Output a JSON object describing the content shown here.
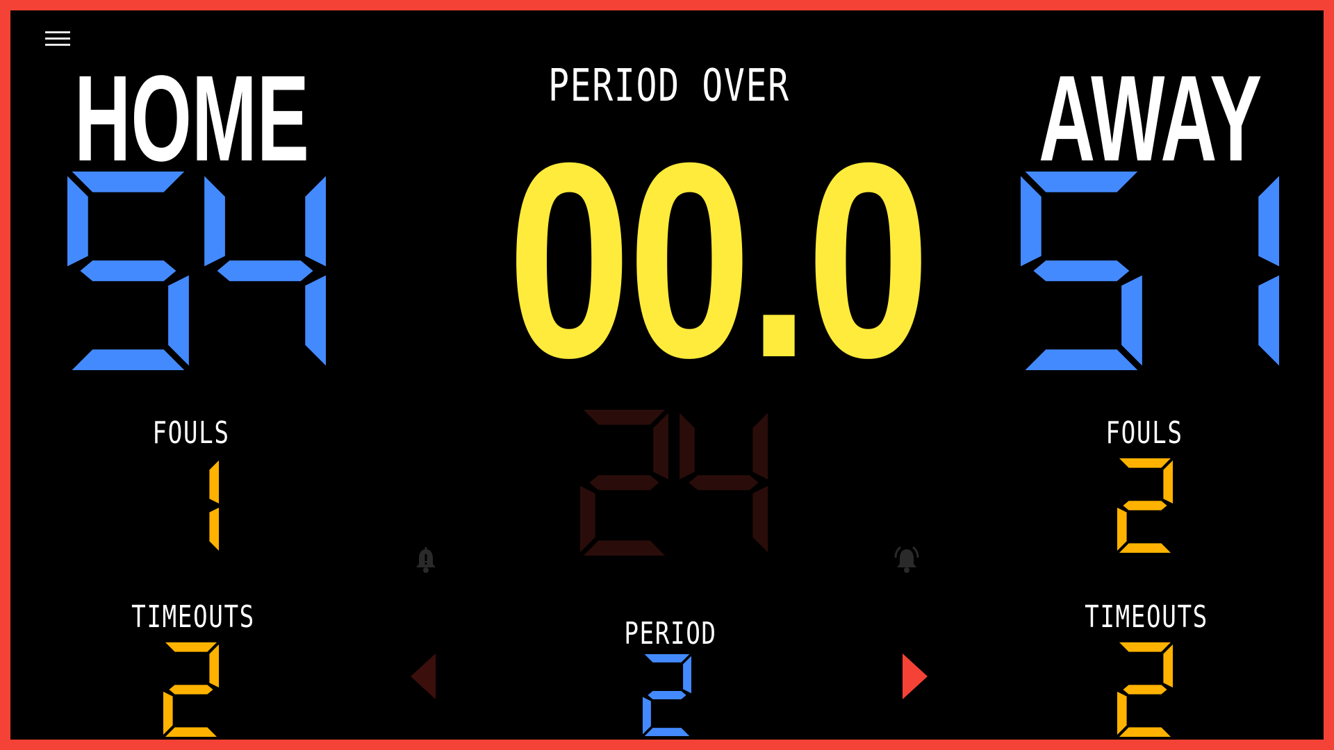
{
  "colors": {
    "border": "#f44336",
    "background": "#000000",
    "score": "#448aff",
    "clock": "#ffeb3b",
    "stat": "#ffb300",
    "shot_clock_dim": "#2a0d0a",
    "arrow_active": "#f44336",
    "arrow_dim": "#3a0f0c"
  },
  "menu": {
    "icon": "hamburger-menu-icon"
  },
  "home": {
    "name": "HOME",
    "score": "54",
    "fouls_label": "FOULS",
    "fouls": "1",
    "timeouts_label": "TIMEOUTS",
    "timeouts": "2"
  },
  "away": {
    "name": "AWAY",
    "score": "51",
    "fouls_label": "FOULS",
    "fouls": "2",
    "timeouts_label": "TIMEOUTS",
    "timeouts": "2"
  },
  "game": {
    "status": "PERIOD OVER",
    "clock": "00.0",
    "shot_clock": "24",
    "period_label": "PERIOD",
    "period": "2"
  },
  "icons": {
    "left_bell": "bell-icon",
    "right_bell": "bell-ring-icon",
    "period_prev": "triangle-left-icon",
    "period_next": "triangle-right-icon"
  }
}
